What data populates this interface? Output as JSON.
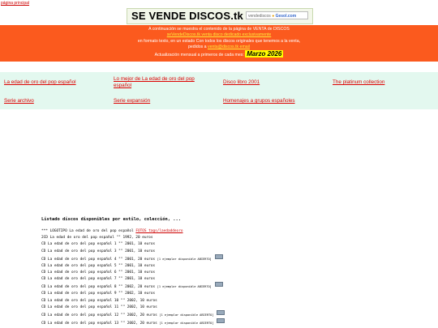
{
  "top_link": "página principal",
  "logo": {
    "title": "SE VENDE DISCOS.tk",
    "search_placeholder": "vendediscos",
    "search_brand": "Gesol.com"
  },
  "banner": {
    "line1": "A continuación se muestra el contenido de la página de VENTA de DISCOS",
    "line2": "seVendeDiscos.tk venta disco dedicado exclusivamente",
    "line3": "en formato texto, en un estado Con todos los discos originales que tenemos a la venta,",
    "line4_pre": "pedidos a",
    "line4_link": "venta@discos.tk email",
    "line5": "Actualización mensual a primeros de cada mes:",
    "month": "Marzo 2026"
  },
  "nav": [
    {
      "label": "La edad de oro del pop español"
    },
    {
      "label": "Lo mejor de La edad de oro del pop español"
    },
    {
      "label": "Disco libro 2001"
    },
    {
      "label": "The platinum collection"
    },
    {
      "label": "Serie archivo"
    },
    {
      "label": "Serie expansión"
    },
    {
      "label": "Homenajes a grupos españoles"
    }
  ],
  "listing": {
    "title": "Listado discos disponibles por estilo, colección, ...",
    "header_text": "*** LOGOTIPO La edad de oro del pop español",
    "header_link": "FOTOS tags/laedaddeoro",
    "rows": [
      {
        "text": "2CD La edad de oro del pop español \"\" 1992, 20 euros",
        "avail": "",
        "cart": false
      },
      {
        "text": "CD La edad de oro del pop español 1 \"\" 2001, 10 euros",
        "avail": "",
        "cart": false
      },
      {
        "text": "CD La edad de oro del pop español 3 \"\" 2001, 10 euros",
        "avail": "",
        "cart": false
      },
      {
        "text": "CD La edad de oro del pop español 4 \"\" 2001, 20 euros",
        "avail": "[1 ejemplar disponible ABIERTO]",
        "cart": true
      },
      {
        "text": "CD La edad de oro del pop español 5 \"\" 2001, 10 euros",
        "avail": "",
        "cart": false
      },
      {
        "text": "CD La edad de oro del pop español 6 \"\" 2001, 10 euros",
        "avail": "",
        "cart": false
      },
      {
        "text": "CD La edad de oro del pop español 7 \"\" 2001, 10 euros",
        "avail": "",
        "cart": false
      },
      {
        "text": "CD La edad de oro del pop español 8 \"\" 2002, 20 euros",
        "avail": "[1 ejemplar disponible ABIERTO]",
        "cart": true
      },
      {
        "text": "CD La edad de oro del pop español 9 \"\" 2002, 10 euros",
        "avail": "",
        "cart": false
      },
      {
        "text": "CD La edad de oro del pop español 10 \"\" 2002, 10 euros",
        "avail": "",
        "cart": false
      },
      {
        "text": "CD La edad de oro del pop español 11 \"\" 2002, 10 euros",
        "avail": "",
        "cart": false
      },
      {
        "text": "CD La edad de oro del pop español 12 \"\" 2002, 20 euros",
        "avail": "[1 ejemplar disponible ABIERTO]",
        "cart": true
      },
      {
        "text": "CD La edad de oro del pop español 13 \"\" 2002, 20 euros",
        "avail": "[1 ejemplar disponible ABIERTO]",
        "cart": true
      }
    ]
  }
}
